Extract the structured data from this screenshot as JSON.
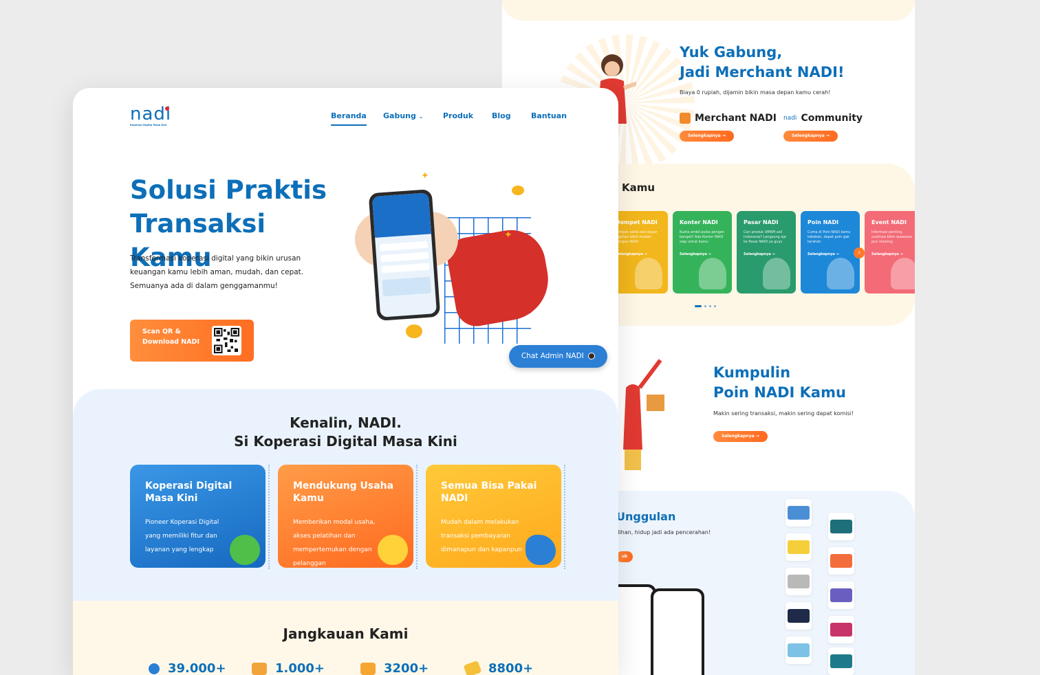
{
  "nav": {
    "logo_text": "nadi",
    "logo_tagline": "Koperasi Digital Masa Kini",
    "items": [
      {
        "label": "Beranda"
      },
      {
        "label": "Gabung"
      },
      {
        "label": "Produk"
      },
      {
        "label": "Blog"
      },
      {
        "label": "Bantuan"
      }
    ]
  },
  "hero": {
    "title": "Solusi Praktis Transaksi Kamu",
    "description": "Transformasi koperasi digital yang bikin urusan keuangan kamu lebih aman, mudah, dan cepat. Semuanya ada di dalam genggamanmu!",
    "qr_button_label": "Scan QR & Download NADI",
    "chat_admin_label": "Chat Admin NADI"
  },
  "intro": {
    "title_line1": "Kenalin, NADI.",
    "title_line2": "Si Koperasi Digital Masa Kini",
    "cards": [
      {
        "title": "Koperasi Digital Masa Kini",
        "desc": "Pioneer Koperasi Digital yang memiliki fitur dan layanan yang lengkap",
        "color": "#1f7dd4"
      },
      {
        "title": "Mendukung Usaha Kamu",
        "desc": "Memberikan modal usaha, akses pelatihan dan mempertemukan dengan pelanggan",
        "color": "#ff7a2a"
      },
      {
        "title": "Semua Bisa Pakai NADI",
        "desc": "Mudah dalam melakukan transaksi pembayaran dimanapun dan kapanpun",
        "color": "#ffb21e"
      }
    ]
  },
  "reach": {
    "title": "Jangkauan Kami",
    "stats": [
      {
        "value": "39.000+"
      },
      {
        "value": "1.000+"
      },
      {
        "value": "3200+"
      },
      {
        "value": "8800+"
      }
    ]
  },
  "merchant": {
    "title_line1": "Yuk Gabung,",
    "title_line2": "Jadi Merchant NADI!",
    "description": "Biaya 0 rupiah, dijamin bikin masa depan kamu cerah!",
    "options": [
      {
        "label": "Merchant NADI",
        "button": "Selengkapnya →"
      },
      {
        "label": "Community",
        "button": "Selengkapnya →"
      }
    ]
  },
  "products": {
    "title": "Kamu",
    "cards": [
      {
        "title": "Dompet NADI",
        "desc": "Simpan saldo dan bayar tagihan lebih mudah dengan NADI",
        "link": "Selengkapnya →",
        "color": "#f2b71c"
      },
      {
        "title": "Konter NADI",
        "desc": "Kuota ambil pulsa pengen banget? Ada Konter NADI siap untuk kamu",
        "link": "Selengkapnya →",
        "color": "#35b35a"
      },
      {
        "title": "Pasar NADI",
        "desc": "Cari produk UMKM asli Indonesia? Langsung aja ke Pasar NADI ya guys",
        "link": "Selengkapnya →",
        "color": "#2a9b6c"
      },
      {
        "title": "Poin NADI",
        "desc": "Cuma di Poin NADI kamu tebakan, dapat poin gak terahsir",
        "link": "Selengkapnya →",
        "color": "#1e88d8"
      },
      {
        "title": "Event NADI",
        "desc": "Informasi penting, sustinya bikin wawasan pun shoving",
        "link": "Selengkapnya →",
        "color": "#f36b77"
      }
    ]
  },
  "poin": {
    "title_line1": "Kumpulin",
    "title_line2": "Poin NADI Kamu",
    "description": "Makin sering transaksi, makin sering dapat komisi!",
    "button": "Selengkapnya →"
  },
  "unggulan": {
    "title": "Unggulan",
    "description": "ilihan, hidup jadi ada pencerahan!",
    "button": "uk"
  }
}
